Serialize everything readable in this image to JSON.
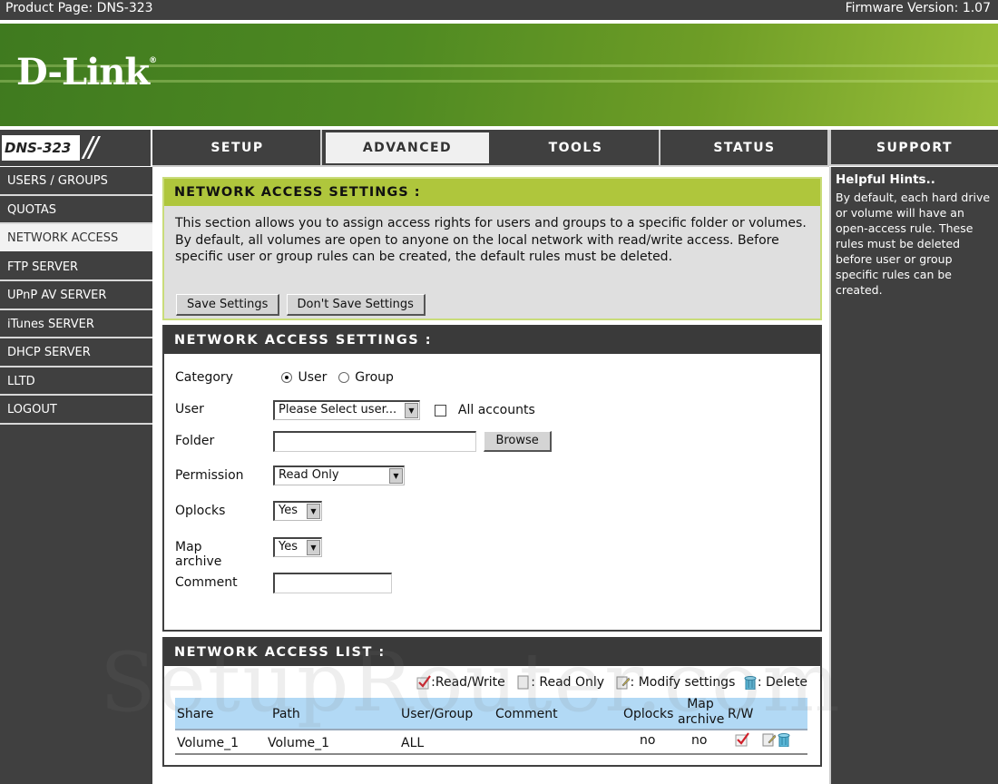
{
  "topbar": {
    "product": "Product Page: DNS-323",
    "firmware": "Firmware Version: 1.07"
  },
  "banner": {
    "logo": "D-Link",
    "registered": "®"
  },
  "model": {
    "name": "DNS-323",
    "slashes": "//"
  },
  "tabs": [
    {
      "label": "SETUP",
      "active": false
    },
    {
      "label": "ADVANCED",
      "active": true
    },
    {
      "label": "TOOLS",
      "active": false
    },
    {
      "label": "STATUS",
      "active": false
    },
    {
      "label": "SUPPORT",
      "active": false
    }
  ],
  "sidebar": {
    "items": [
      {
        "label": "USERS / GROUPS"
      },
      {
        "label": "QUOTAS"
      },
      {
        "label": "NETWORK ACCESS",
        "active": true
      },
      {
        "label": "FTP SERVER"
      },
      {
        "label": "UPnP AV SERVER"
      },
      {
        "label": "iTunes SERVER"
      },
      {
        "label": "DHCP SERVER"
      },
      {
        "label": "LLTD"
      },
      {
        "label": "LOGOUT"
      }
    ]
  },
  "hints": {
    "title": "Helpful Hints..",
    "text": "By default, each hard drive or volume will have an open-access rule. These rules must be deleted before user or group specific rules can be created."
  },
  "intro": {
    "title": "NETWORK ACCESS SETTINGS :",
    "description": "This section allows you to assign access rights for users and groups to a specific folder or volumes. By default, all volumes are open to anyone on the local network with read/write access. Before specific user or group rules can be created, the default rules must be deleted.",
    "save_label": "Save Settings",
    "dont_save_label": "Don't Save Settings"
  },
  "settings": {
    "title": "NETWORK ACCESS SETTINGS :",
    "category": {
      "label": "Category",
      "options": [
        "User",
        "Group"
      ],
      "selected": "User"
    },
    "user": {
      "label": "User",
      "value": "Please Select user...",
      "all_accounts_label": "All accounts",
      "all_accounts_checked": false
    },
    "folder": {
      "label": "Folder",
      "value": "",
      "browse_label": "Browse"
    },
    "permission": {
      "label": "Permission",
      "value": "Read Only"
    },
    "oplocks": {
      "label": "Oplocks",
      "value": "Yes"
    },
    "map_archive": {
      "label": "Map archive",
      "value": "Yes"
    },
    "comment": {
      "label": "Comment",
      "value": ""
    }
  },
  "list": {
    "title": "NETWORK ACCESS LIST :",
    "legend": {
      "read_write": ":Read/Write",
      "read_only": ": Read Only",
      "modify": ": Modify settings",
      "delete": ": Delete"
    },
    "columns": [
      "Share",
      "Path",
      "User/Group",
      "Comment",
      "Oplocks",
      "Map archive",
      "R/W"
    ],
    "rows": [
      {
        "share": "Volume_1",
        "path": "Volume_1",
        "user_group": "ALL",
        "comment": "",
        "oplocks": "no",
        "map_archive": "no",
        "rw": "read-write"
      }
    ]
  },
  "watermark": "SetupRouter.com",
  "colors": {
    "dark": "#404040",
    "accent_green": "#afc63c",
    "table_header": "#b2d9f5"
  }
}
